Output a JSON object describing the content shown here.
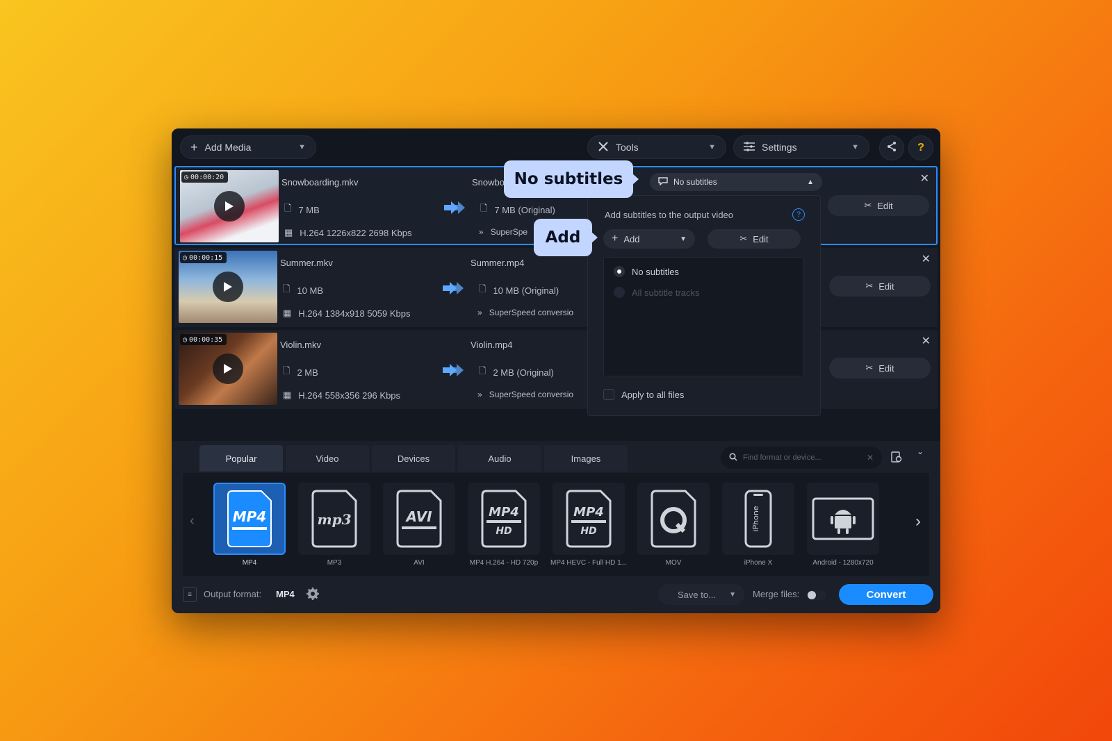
{
  "toolbar": {
    "add_media": "Add Media",
    "tools": "Tools",
    "settings": "Settings",
    "help": "?"
  },
  "files": [
    {
      "duration": "00:00:20",
      "name": "Snowboarding.mkv",
      "size": "7 MB",
      "codec": "H.264 1226x822 2698 Kbps",
      "output_name": "Snowbo",
      "output_size": "7 MB (Original)",
      "output_conv": "SuperSpe",
      "edit": "Edit"
    },
    {
      "duration": "00:00:15",
      "name": "Summer.mkv",
      "size": "10 MB",
      "codec": "H.264 1384x918 5059 Kbps",
      "output_name": "Summer.mp4",
      "output_size": "10 MB (Original)",
      "output_conv": "SuperSpeed conversio",
      "edit": "Edit"
    },
    {
      "duration": "00:00:35",
      "name": "Violin.mkv",
      "size": "2 MB",
      "codec": "H.264 558x356 296 Kbps",
      "output_name": "Violin.mp4",
      "output_size": "2 MB (Original)",
      "output_conv": "SuperSpeed conversio",
      "edit": "Edit"
    }
  ],
  "subtitles": {
    "selected": "No subtitles",
    "panel_title": "Add subtitles to the output video",
    "add": "Add",
    "edit": "Edit",
    "options": [
      "No subtitles",
      "All subtitle tracks"
    ],
    "apply_all": "Apply to all files"
  },
  "callouts": {
    "no_subtitles": "No subtitles",
    "add": "Add"
  },
  "tabs": [
    "Popular",
    "Video",
    "Devices",
    "Audio",
    "Images"
  ],
  "search_placeholder": "Find format or device...",
  "formats": [
    {
      "label": "MP4",
      "icon": "mp4-icon"
    },
    {
      "label": "MP3",
      "icon": "mp3-icon"
    },
    {
      "label": "AVI",
      "icon": "avi-icon"
    },
    {
      "label": "MP4 H.264 - HD 720p",
      "icon": "mp4-hd-icon"
    },
    {
      "label": "MP4 HEVC - Full HD 1...",
      "icon": "mp4-hevc-icon"
    },
    {
      "label": "MOV",
      "icon": "quicktime-icon"
    },
    {
      "label": "iPhone X",
      "icon": "iphone-icon"
    },
    {
      "label": "Android - 1280x720",
      "icon": "android-icon"
    }
  ],
  "footer": {
    "output_label": "Output format:",
    "output_value": "MP4",
    "save_to": "Save to...",
    "merge": "Merge files:",
    "convert": "Convert"
  },
  "colors": {
    "accent": "#1a8cff",
    "callout": "#c3d6ff"
  }
}
